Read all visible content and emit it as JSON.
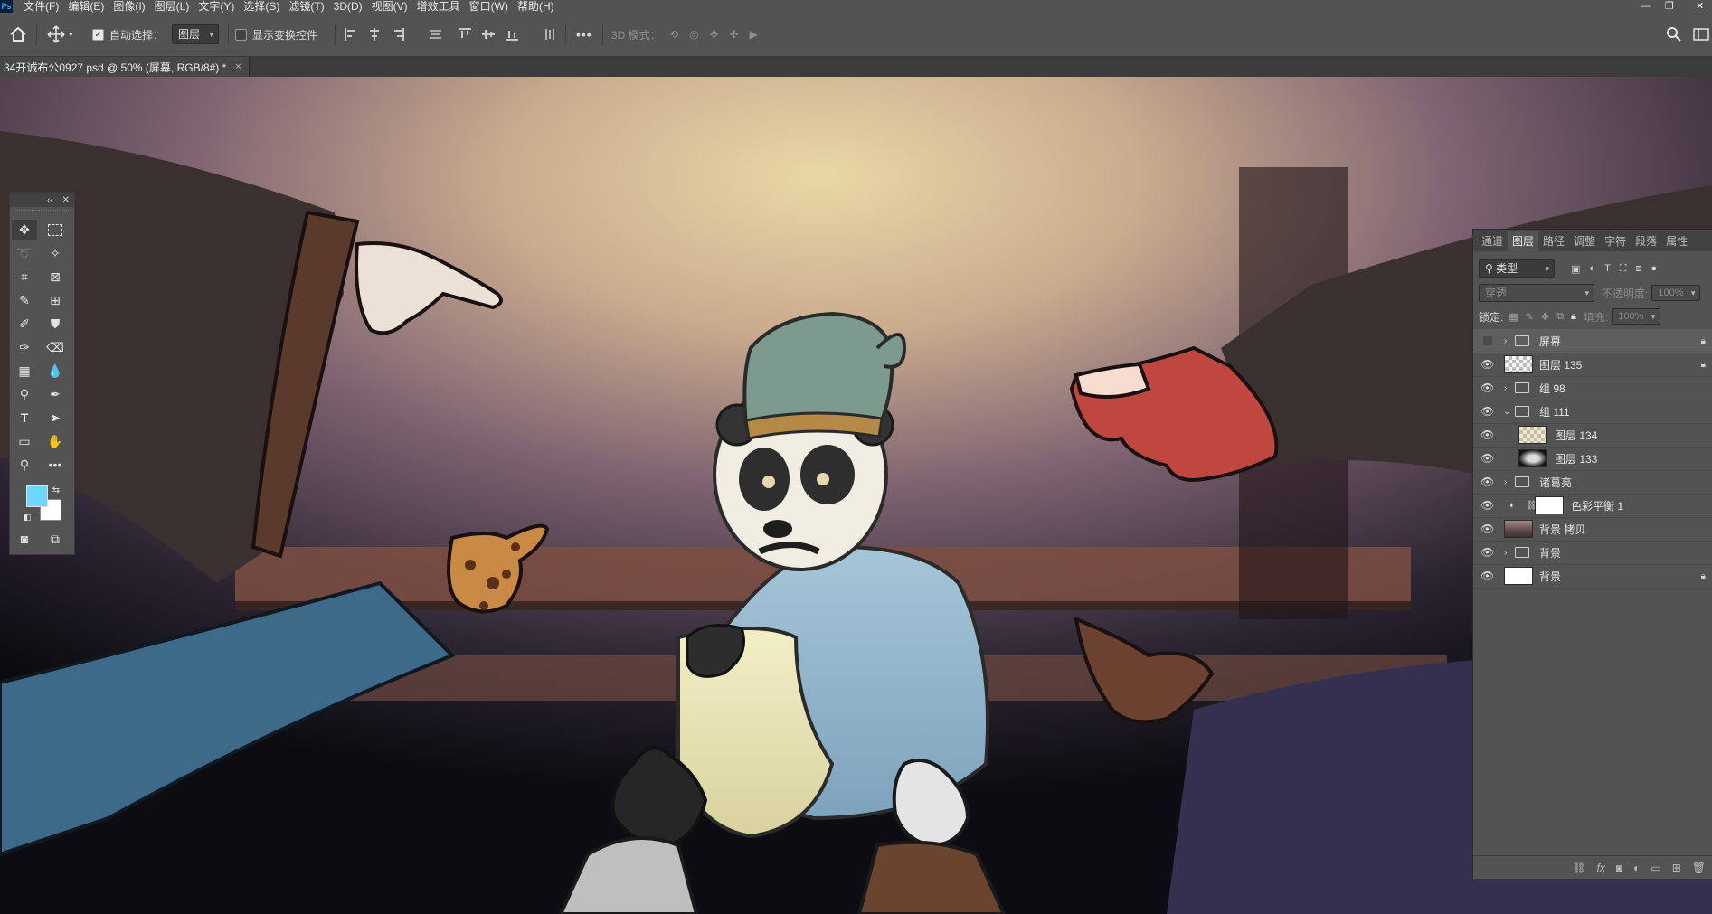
{
  "menu": {
    "logo": "Ps",
    "items": [
      "文件(F)",
      "编辑(E)",
      "图像(I)",
      "图层(L)",
      "文字(Y)",
      "选择(S)",
      "滤镜(T)",
      "3D(D)",
      "视图(V)",
      "增效工具",
      "窗口(W)",
      "帮助(H)"
    ]
  },
  "window": {
    "minimize": "—",
    "restore": "❐",
    "close": "✕"
  },
  "options": {
    "auto_select_label": "自动选择：",
    "auto_select_checked": "✓",
    "auto_select_target": "图层",
    "show_transform_label": "显示变换控件",
    "more": "•••",
    "mode_3d_label": "3D 模式："
  },
  "document_tab": {
    "title": "34开诚布公0927.psd @ 50% (屏幕, RGB/8#) *",
    "close": "×"
  },
  "toolbox": {
    "collapse": "‹‹",
    "close": "✕"
  },
  "layers_panel": {
    "tabs": [
      "通道",
      "图层",
      "路径",
      "调整",
      "字符",
      "段落",
      "属性"
    ],
    "active_tab": "图层",
    "filter_label": "类型",
    "blend_mode": "穿透",
    "opacity_label": "不透明度:",
    "opacity_value": "100%",
    "lock_label": "锁定:",
    "fill_label": "填充:",
    "fill_value": "100%",
    "layers": [
      {
        "name": "屏幕",
        "kind": "group",
        "visible": false,
        "locked": true,
        "expanded": false,
        "indent": 0
      },
      {
        "name": "图层 135",
        "kind": "layer",
        "visible": true,
        "locked": true,
        "indent": 0,
        "thumb": "checker"
      },
      {
        "name": "组 98",
        "kind": "group",
        "visible": true,
        "expanded": false,
        "indent": 0
      },
      {
        "name": "组 111",
        "kind": "group",
        "visible": true,
        "expanded": true,
        "indent": 0
      },
      {
        "name": "图层 134",
        "kind": "layer",
        "visible": true,
        "indent": 1,
        "thumb": "checker"
      },
      {
        "name": "图层 133",
        "kind": "layer",
        "visible": true,
        "indent": 1,
        "thumb": "dark"
      },
      {
        "name": "诸葛亮",
        "kind": "group",
        "visible": true,
        "expanded": false,
        "indent": 0
      },
      {
        "name": "色彩平衡 1",
        "kind": "adjustment",
        "visible": true,
        "indent": 0
      },
      {
        "name": "背景 拷贝",
        "kind": "layer",
        "visible": true,
        "indent": 0,
        "thumb": "image"
      },
      {
        "name": "背景",
        "kind": "group",
        "visible": true,
        "expanded": false,
        "indent": 0
      },
      {
        "name": "背景",
        "kind": "layer",
        "visible": true,
        "locked": true,
        "indent": 0,
        "thumb": "white"
      }
    ]
  },
  "colors": {
    "foreground": "#6fd6ff",
    "background": "#ffffff",
    "ui_panel": "#535353",
    "ui_dark": "#3c3c3c"
  },
  "artwork": {
    "description_icon": "panda-official-illustration-icon"
  }
}
